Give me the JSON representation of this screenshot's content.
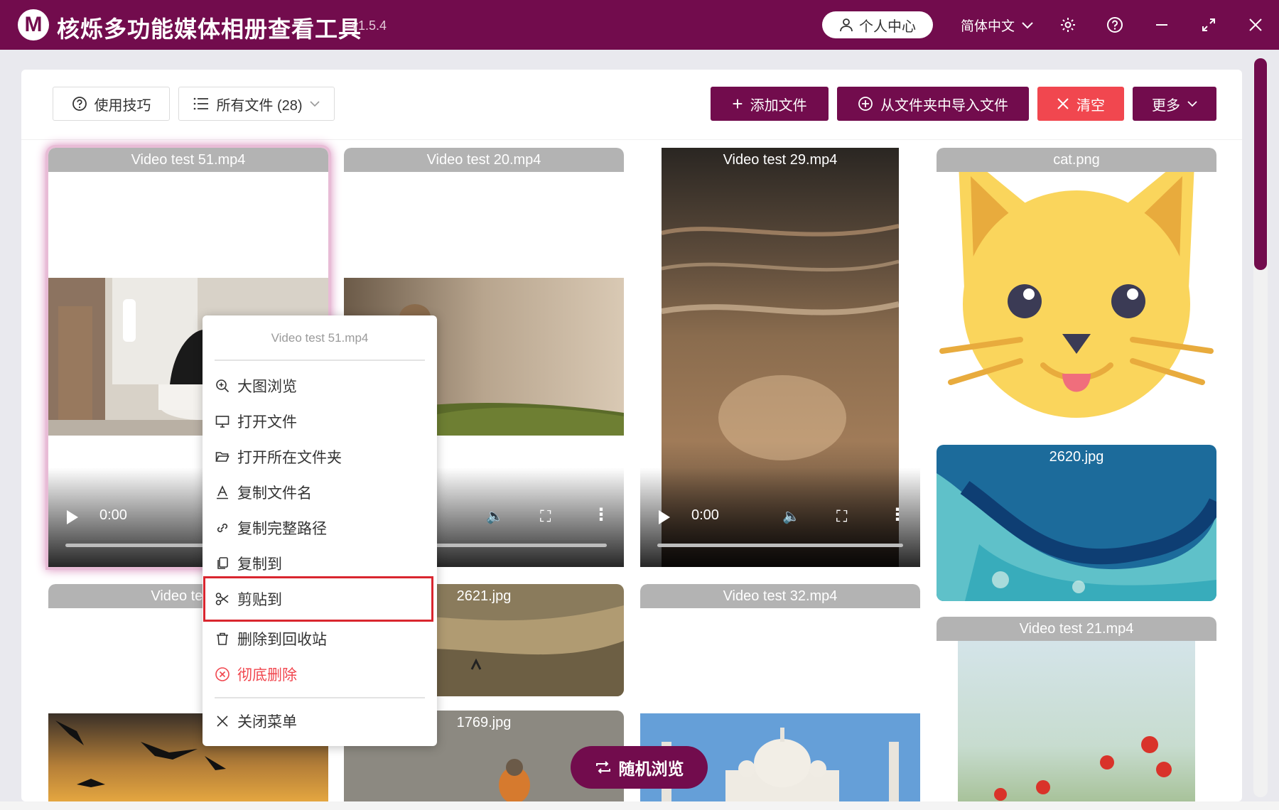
{
  "app": {
    "logo_letter": "M",
    "title": "核烁多功能媒体相册查看工具",
    "version": "- v1.5.4",
    "user_center": "个人中心",
    "language": "简体中文",
    "accent_color": "#720c4d",
    "danger_color": "#f1474f"
  },
  "toolbar": {
    "tips": "使用技巧",
    "filter": "所有文件 (28)",
    "add_file": "添加文件",
    "import_folder": "从文件夹中导入文件",
    "clear": "清空",
    "more": "更多"
  },
  "cards": [
    {
      "name": "Video test 51.mp4",
      "time": "0:00"
    },
    {
      "name": "Video test 20.mp4"
    },
    {
      "name": "Video test 29.mp4",
      "time": "0:00"
    },
    {
      "name": "cat.png"
    },
    {
      "name": "2620.jpg"
    },
    {
      "name": "Video test 2"
    },
    {
      "name": "2621.jpg"
    },
    {
      "name": "Video test 32.mp4"
    },
    {
      "name": "Video test 21.mp4"
    },
    {
      "name": "1769.jpg"
    }
  ],
  "context_menu": {
    "title": "Video test 51.mp4",
    "items": [
      {
        "label": "大图浏览",
        "icon": "zoom-in-icon"
      },
      {
        "label": "打开文件",
        "icon": "monitor-icon"
      },
      {
        "label": "打开所在文件夹",
        "icon": "folder-open-icon"
      },
      {
        "label": "复制文件名",
        "icon": "text-icon"
      },
      {
        "label": "复制完整路径",
        "icon": "link-icon"
      },
      {
        "label": "复制到",
        "icon": "copy-icon"
      },
      {
        "label": "剪贴到",
        "icon": "scissors-icon"
      },
      {
        "label": "删除到回收站",
        "icon": "trash-icon"
      },
      {
        "label": "彻底删除",
        "icon": "close-circle-icon"
      }
    ],
    "close": "关闭菜单"
  },
  "random_browse": "随机浏览"
}
